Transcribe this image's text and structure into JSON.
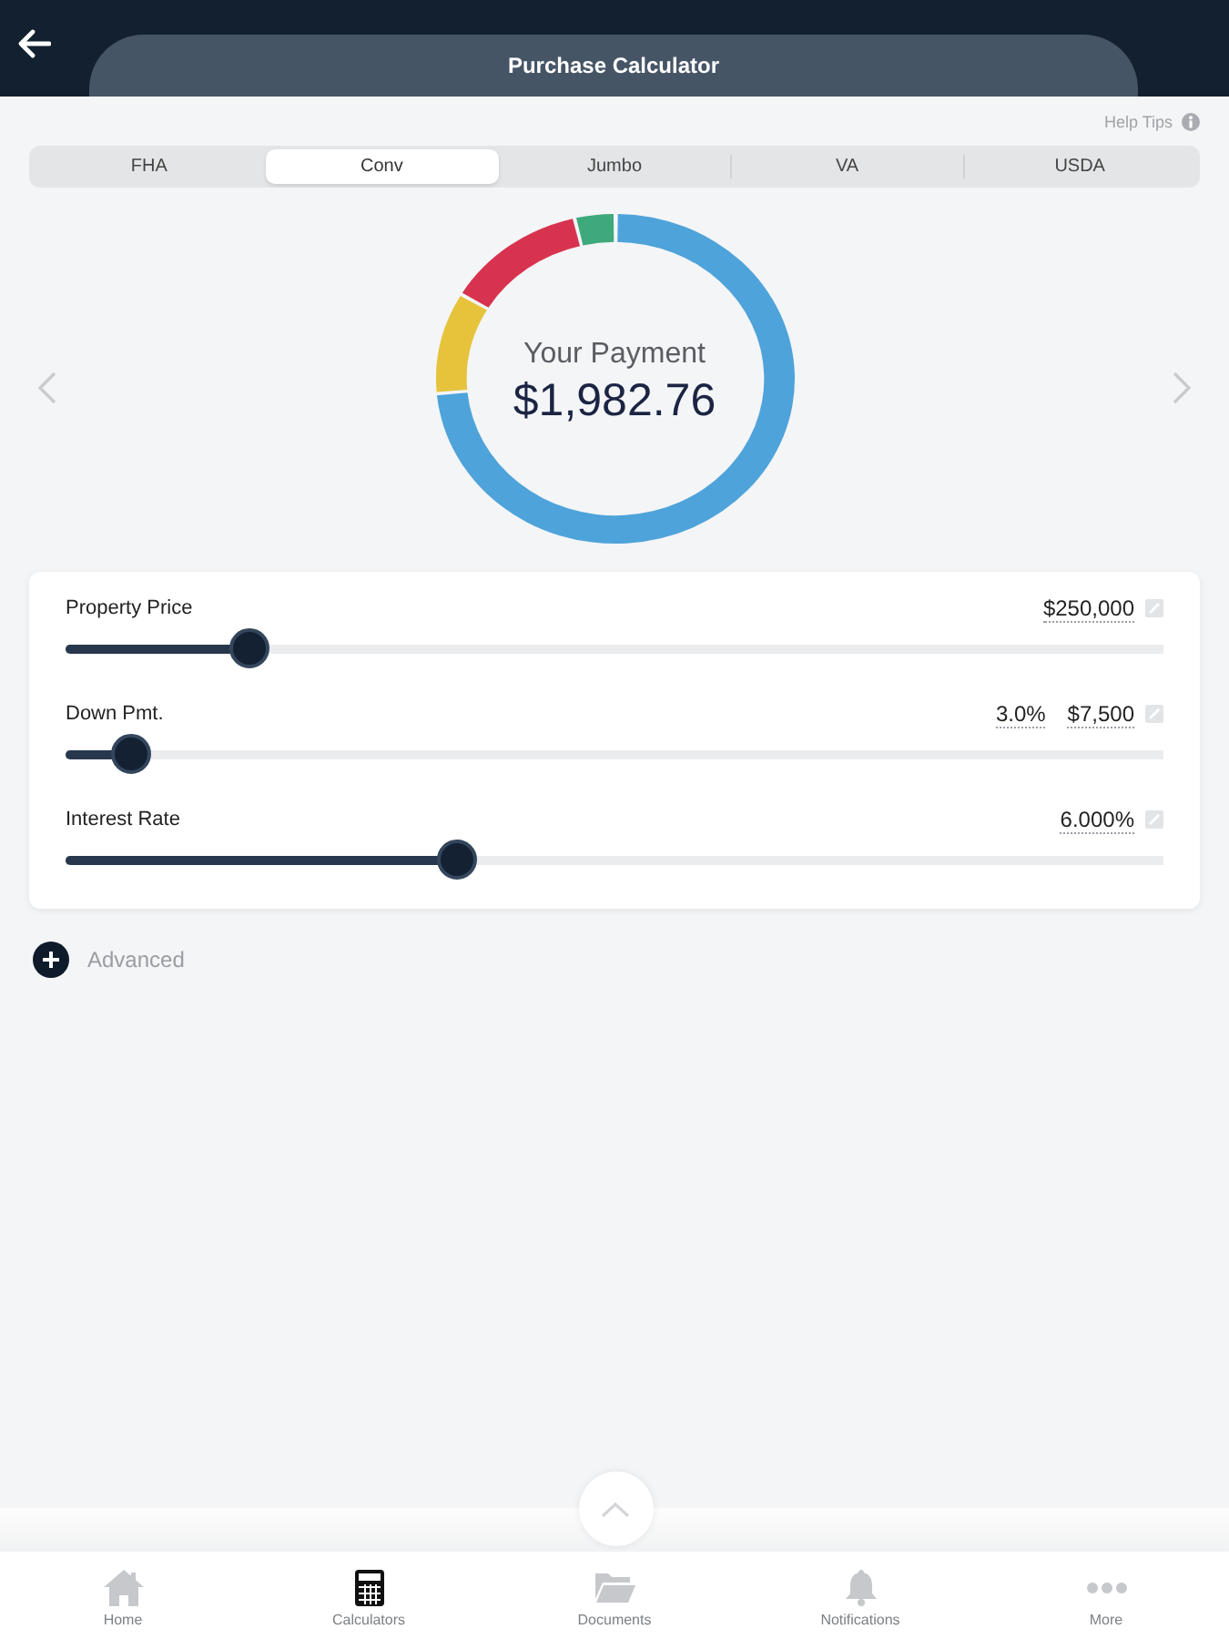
{
  "header": {
    "title": "Purchase Calculator"
  },
  "help_tips": {
    "label": "Help Tips"
  },
  "loan_types": [
    {
      "label": "FHA",
      "selected": false
    },
    {
      "label": "Conv",
      "selected": true
    },
    {
      "label": "Jumbo",
      "selected": false
    },
    {
      "label": "VA",
      "selected": false
    },
    {
      "label": "USDA",
      "selected": false
    }
  ],
  "payment": {
    "label": "Your Payment",
    "amount": "$1,982.76"
  },
  "inputs": [
    {
      "label": "Property Price",
      "values": [
        "$250,000"
      ],
      "level": 0.168
    },
    {
      "label": "Down Pmt.",
      "values": [
        "3.0%",
        "$7,500"
      ],
      "level": 0.06
    },
    {
      "label": "Interest Rate",
      "values": [
        "6.000%"
      ],
      "level": 0.357
    }
  ],
  "advanced": {
    "label": "Advanced"
  },
  "bottom_nav": [
    {
      "label": "Home",
      "selected": false
    },
    {
      "label": "Calculators",
      "selected": true
    },
    {
      "label": "Documents",
      "selected": false
    },
    {
      "label": "Notifications",
      "selected": false
    },
    {
      "label": "More",
      "selected": false
    }
  ]
}
